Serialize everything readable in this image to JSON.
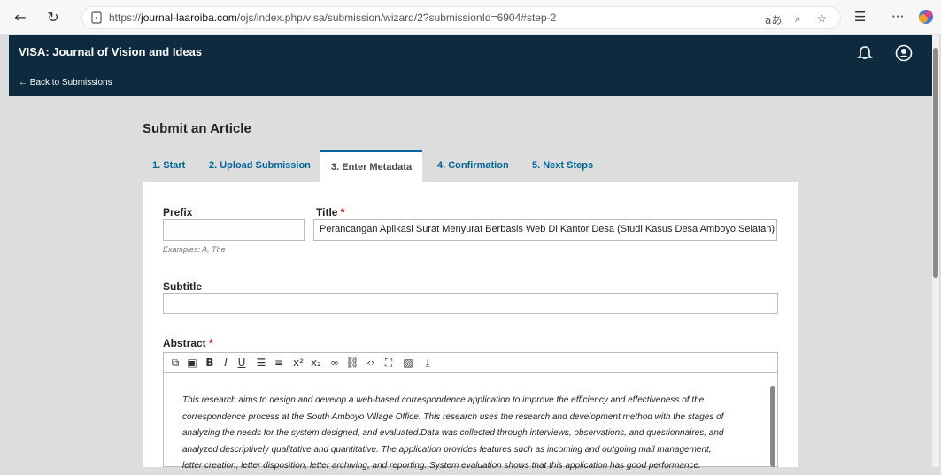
{
  "browser": {
    "url_prefix": "https://",
    "url_domain": "journal-laaroiba.com",
    "url_path": "/ojs/index.php/visa/submission/wizard/2?submissionId=6904#step-2",
    "read_aloud": "aあ"
  },
  "header": {
    "site_title": "VISA: Journal of Vision and Ideas",
    "back_link": "← Back to Submissions"
  },
  "page": {
    "title": "Submit an Article"
  },
  "tabs": [
    {
      "label": "1. Start"
    },
    {
      "label": "2. Upload Submission"
    },
    {
      "label": "3. Enter Metadata"
    },
    {
      "label": "4. Confirmation"
    },
    {
      "label": "5. Next Steps"
    }
  ],
  "form": {
    "prefix_label": "Prefix",
    "prefix_value": "",
    "prefix_hint": "Examples: A, The",
    "title_label": "Title",
    "required_mark": "*",
    "title_value": "Perancangan Aplikasi Surat Menyurat Berbasis Web Di Kantor Desa  (Studi Kasus Desa Amboyo Selatan)",
    "subtitle_label": "Subtitle",
    "subtitle_value": "",
    "abstract_label": "Abstract",
    "abstract_lines": [
      "This research aims to design and develop a web-based correspondence application to improve the efficiency and effectiveness of the",
      "correspondence process at the South Amboyo Village Office. This research uses the research and development method with the stages of",
      "analyzing the needs for the system designed, and evaluated.Data was collected through interviews, observations, and questionnaires, and",
      "analyzed descriptively qualitative and quantitative. The application provides features such as incoming and outgoing mail management,",
      "letter creation, letter disposition, letter archiving, and reporting. System evaluation shows that this application has good performance."
    ]
  },
  "colors": {
    "header_bg": "#0d2a3f",
    "accent": "#006798",
    "required": "#dd0000"
  }
}
